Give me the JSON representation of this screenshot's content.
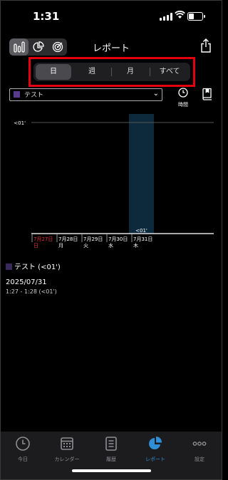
{
  "status": {
    "time": "1:31"
  },
  "header": {
    "title": "レポート"
  },
  "segments": [
    {
      "label": "日",
      "selected": true
    },
    {
      "label": "週",
      "selected": false
    },
    {
      "label": "月",
      "selected": false
    },
    {
      "label": "すべて",
      "selected": false
    }
  ],
  "filter": {
    "value": "テスト"
  },
  "time_button": {
    "label": "時間"
  },
  "chart_data": {
    "type": "bar",
    "categories": [
      "7月27日 日",
      "7月28日 月",
      "7月29日 火",
      "7月30日 水",
      "7月31日 木"
    ],
    "category_days": [
      "7月27日",
      "7月28日",
      "7月29日",
      "7月30日",
      "7月31日"
    ],
    "category_weekdays": [
      "日",
      "月",
      "火",
      "水",
      "木"
    ],
    "values": [
      0,
      0,
      0,
      0,
      1
    ],
    "bar_label": "<01'",
    "ytick": "<01'",
    "accent_colors": {
      "bar": "#0d2a3c",
      "sunday": "#e8333a"
    }
  },
  "legend": {
    "text": "テスト (<01')"
  },
  "detail": {
    "date": "2025/07/31",
    "time": "1:27 - 1:28 (<01')"
  },
  "tabbar": [
    {
      "label": "今日",
      "icon": "clock-icon",
      "active": false
    },
    {
      "label": "カレンダー",
      "icon": "calendar-icon",
      "active": false
    },
    {
      "label": "履歴",
      "icon": "history-icon",
      "active": false
    },
    {
      "label": "レポート",
      "icon": "pie-chart-icon",
      "active": true
    },
    {
      "label": "設定",
      "icon": "more-icon",
      "active": false
    }
  ],
  "colors": {
    "accent": "#2f8fd6",
    "highlight": "#e3000f"
  }
}
